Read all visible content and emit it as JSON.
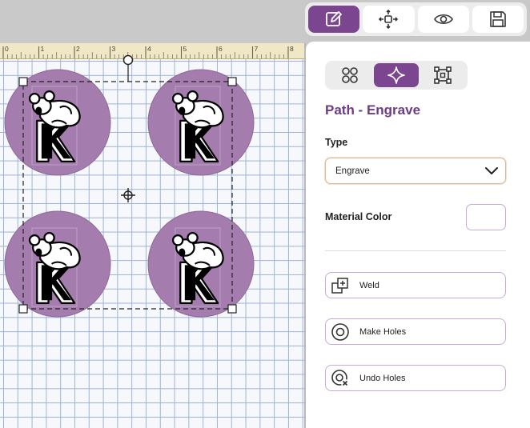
{
  "toolbar": {
    "items": [
      {
        "name": "edit",
        "icon": "pencil-square-icon",
        "active": true
      },
      {
        "name": "arrange",
        "icon": "move-arrows-icon",
        "active": false
      },
      {
        "name": "preview",
        "icon": "eye-icon",
        "active": false
      },
      {
        "name": "save",
        "icon": "save-disk-icon",
        "active": false
      }
    ]
  },
  "ruler": {
    "labels": [
      "0",
      "1",
      "2",
      "3",
      "4",
      "5",
      "6",
      "7",
      "8"
    ]
  },
  "canvas": {
    "design_color": "#a47cae",
    "design_letter": "K",
    "design_count": 4
  },
  "panel": {
    "subtabs": [
      {
        "icon": "four-circles-icon",
        "active": false
      },
      {
        "icon": "sparkle-icon",
        "active": true
      },
      {
        "icon": "bounding-box-icon",
        "active": false
      }
    ],
    "title": "Path - Engrave",
    "type_label": "Type",
    "type_value": "Engrave",
    "material_color_label": "Material Color",
    "actions": [
      {
        "label": "Weld",
        "icon": "weld-icon"
      },
      {
        "label": "Make Holes",
        "icon": "make-holes-icon"
      },
      {
        "label": "Undo Holes",
        "icon": "undo-holes-icon"
      }
    ]
  },
  "colors": {
    "accent": "#7b4590",
    "title": "#6e3c84",
    "design_fill": "#a47cae"
  }
}
